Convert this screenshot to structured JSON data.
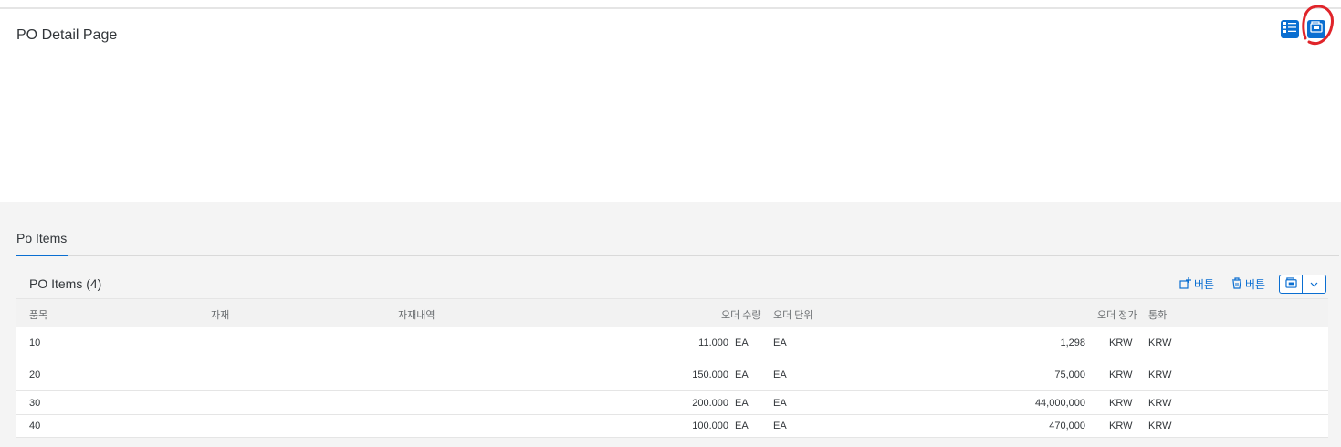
{
  "page": {
    "title": "PO Detail Page"
  },
  "header_actions": [
    {
      "icon": "list-icon"
    },
    {
      "icon": "copy-icon"
    }
  ],
  "tabs": [
    {
      "label": "Po Items",
      "selected": true
    }
  ],
  "table": {
    "title": "PO Items (4)",
    "toolbar": {
      "add_label": "버튼",
      "delete_label": "버튼"
    },
    "columns": [
      "품목",
      "자재",
      "자재내역",
      "오더 수량",
      "오더 단위",
      "오더 정가",
      "통화"
    ],
    "rows": [
      {
        "item": "10",
        "qty": "11.000",
        "qty_unit": "EA",
        "unit": "EA",
        "price": "1,298",
        "price_cur": "KRW",
        "currency": "KRW"
      },
      {
        "item": "20",
        "qty": "150.000",
        "qty_unit": "EA",
        "unit": "EA",
        "price": "75,000",
        "price_cur": "KRW",
        "currency": "KRW"
      },
      {
        "item": "30",
        "qty": "200.000",
        "qty_unit": "EA",
        "unit": "EA",
        "price": "44,000,000",
        "price_cur": "KRW",
        "currency": "KRW"
      },
      {
        "item": "40",
        "qty": "100.000",
        "qty_unit": "EA",
        "unit": "EA",
        "price": "470,000",
        "price_cur": "KRW",
        "currency": "KRW"
      }
    ]
  },
  "colors": {
    "accent": "#0a6ed1",
    "annotation": "#e0242a",
    "content_bg": "#f4f4f4"
  }
}
